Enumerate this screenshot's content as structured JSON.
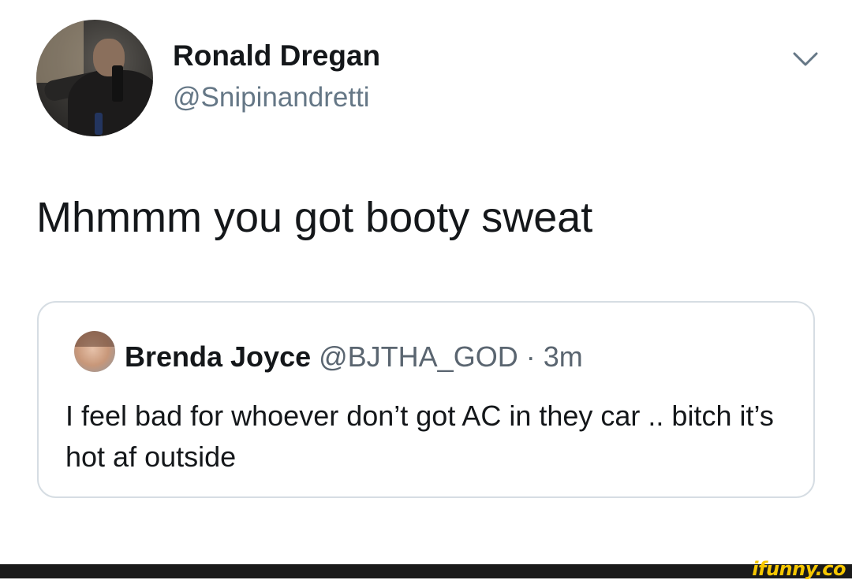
{
  "tweet": {
    "author": {
      "name": "Ronald Dregan",
      "handle": "@Snipinandretti"
    },
    "text": "Mhmmm you got booty sweat",
    "menu_icon": "chevron-down-icon"
  },
  "quoted_tweet": {
    "author_name": "Brenda Joyce",
    "author_handle": "@BJTHA_GOD",
    "time": "· 3m",
    "text": "I feel bad for whoever don’t got AC in they car .. bitch it’s hot af outside"
  },
  "watermark": {
    "text": "ifunny.co",
    "color": "#f6c700"
  },
  "colors": {
    "primary_text": "#14171a",
    "secondary_text": "#657786",
    "border": "#d6dde3"
  }
}
